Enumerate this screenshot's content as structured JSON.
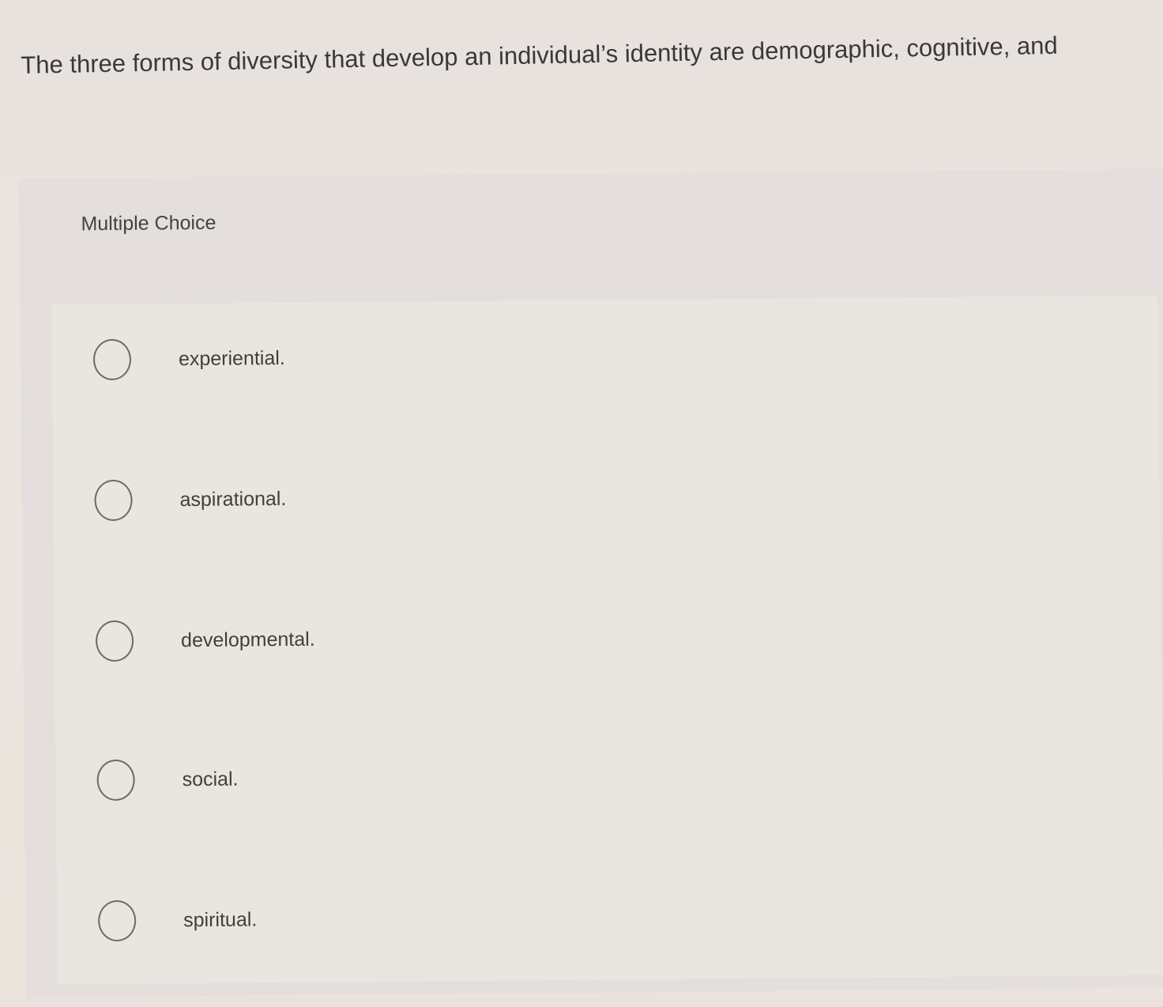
{
  "question": {
    "text": "The three forms of diversity that develop an individual’s identity are demographic, cognitive, and"
  },
  "multiple_choice": {
    "label": "Multiple Choice",
    "options": [
      {
        "label": "experiential.",
        "icon": "radio-unselected-icon",
        "selected": false
      },
      {
        "label": "aspirational.",
        "icon": "radio-unselected-icon",
        "selected": false
      },
      {
        "label": "developmental.",
        "icon": "radio-unselected-icon",
        "selected": false
      },
      {
        "label": "social.",
        "icon": "radio-unselected-icon",
        "selected": false
      },
      {
        "label": "spiritual.",
        "icon": "radio-unselected-icon",
        "selected": false
      }
    ]
  }
}
